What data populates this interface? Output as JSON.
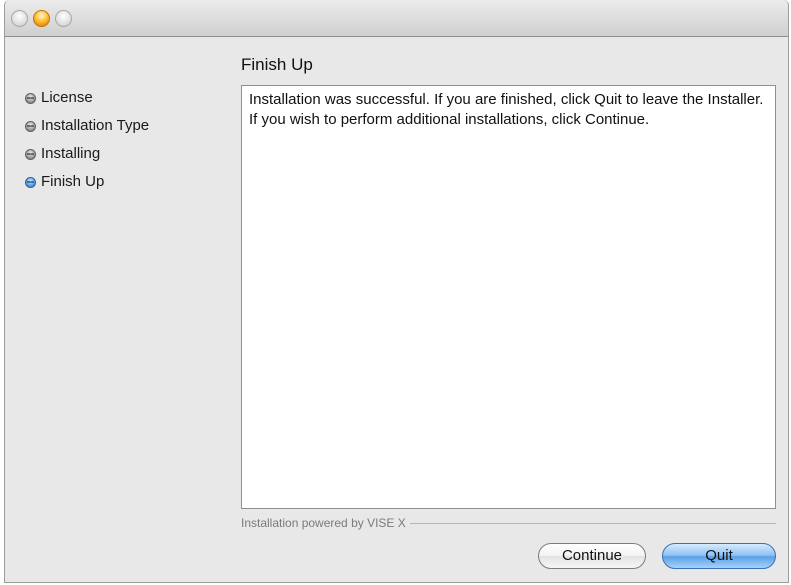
{
  "window": {
    "title": ""
  },
  "sidebar": {
    "steps": [
      {
        "label": "License",
        "state": "done"
      },
      {
        "label": "Installation Type",
        "state": "done"
      },
      {
        "label": "Installing",
        "state": "done"
      },
      {
        "label": "Finish Up",
        "state": "current"
      }
    ]
  },
  "main": {
    "heading": "Finish Up",
    "message": "Installation was successful. If you are finished, click Quit to leave the Installer. If you wish to perform additional installations, click Continue.",
    "powered_by": "Installation powered by VISE X"
  },
  "buttons": {
    "continue_label": "Continue",
    "quit_label": "Quit"
  },
  "colors": {
    "window_bg": "#e8e8e8",
    "current_step_bullet": "#3c85d8",
    "default_button": "#6aaaf0"
  },
  "icons": {
    "close": "close-icon",
    "minimize": "minimize-icon",
    "zoom": "zoom-icon",
    "step_bullet": "step-bullet-icon"
  }
}
